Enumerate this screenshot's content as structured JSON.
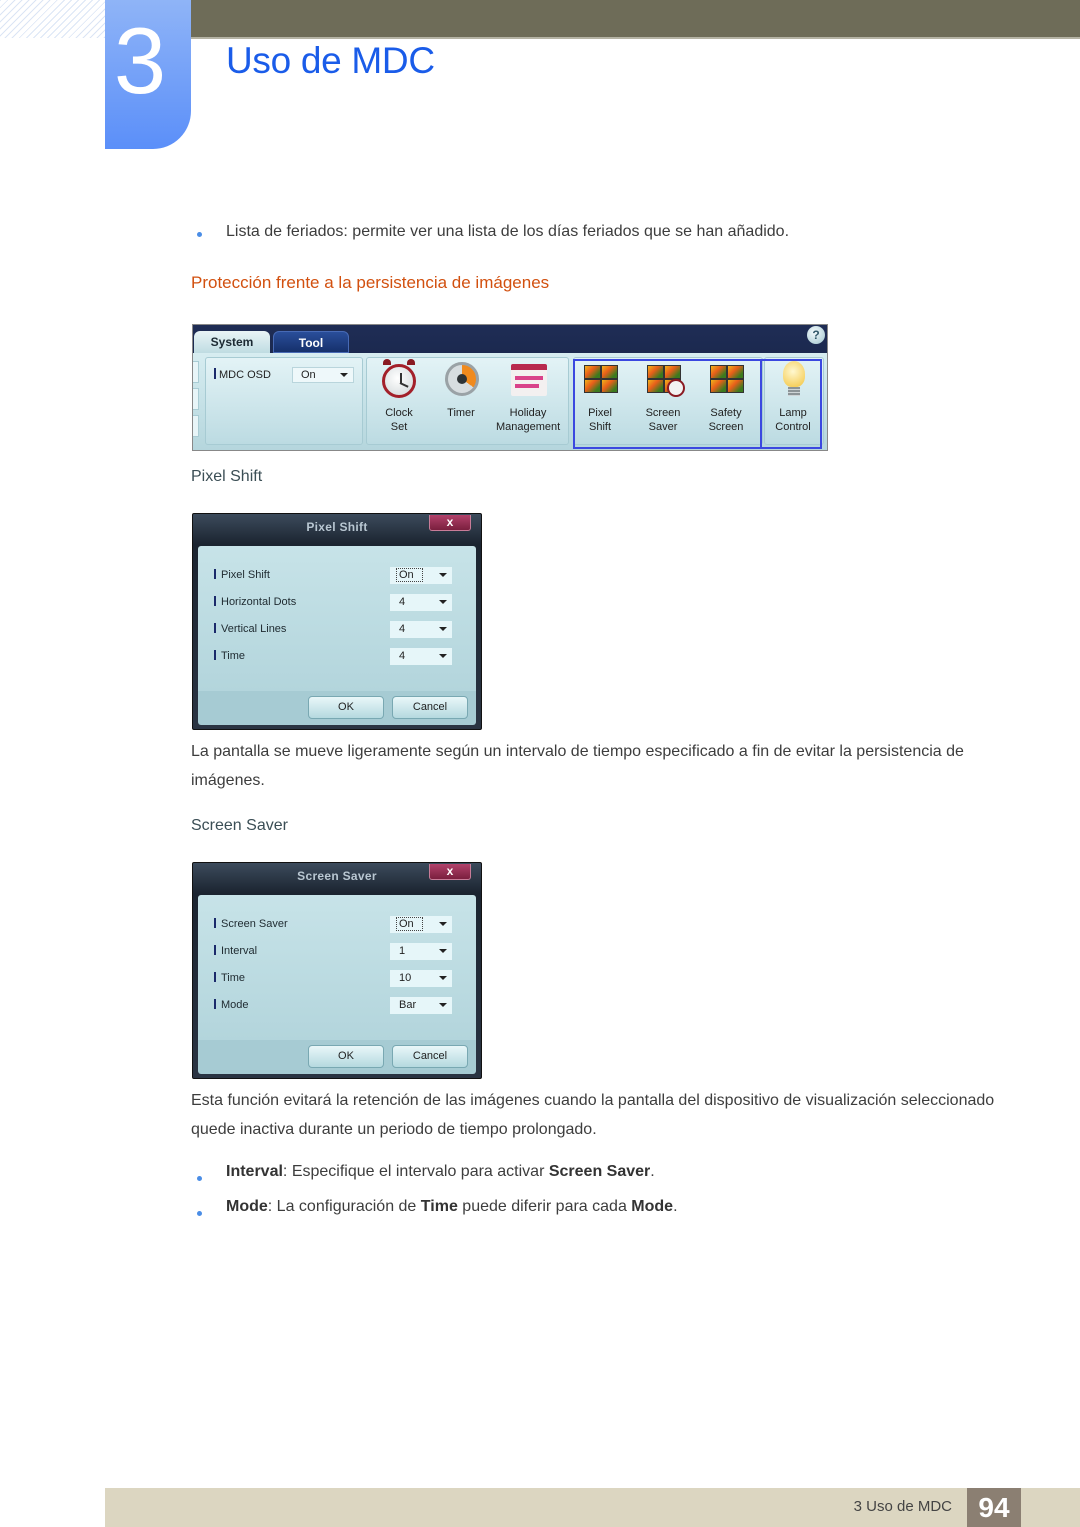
{
  "header": {
    "chapter_number": "3",
    "chapter_title": "Uso de MDC"
  },
  "content": {
    "bullet_holiday": "Lista de feriados: permite ver una lista de los días feriados que se han añadido.",
    "section_heading": "Protección frente a la persistencia de imágenes",
    "pixel_shift_heading": "Pixel Shift",
    "pixel_shift_description": "La pantalla se mueve ligeramente según un intervalo de tiempo especificado a fin de evitar la persistencia de imágenes.",
    "screen_saver_heading": "Screen Saver",
    "screen_saver_description": "Esta función evitará la retención de las imágenes cuando la pantalla del dispositivo de visualización seleccionado quede inactiva durante un periodo de tiempo prolongado.",
    "bullets": [
      {
        "term": "Interval",
        "text_before": ": Especifique el intervalo para activar ",
        "emphasis": "Screen Saver",
        "text_after": "."
      },
      {
        "term": "Mode",
        "text_before": ": La configuración de ",
        "emphasis": "Time",
        "text_mid": " puede diferir para cada ",
        "emphasis2": "Mode",
        "text_after": "."
      }
    ]
  },
  "ribbon": {
    "tabs": [
      {
        "label": "System",
        "active": true
      },
      {
        "label": "Tool",
        "active": false
      }
    ],
    "help_icon": "?",
    "mdc_osd": {
      "label": "MDC OSD",
      "value": "On"
    },
    "buttons": [
      {
        "icon": "alarm-clock-icon",
        "line1": "Clock",
        "line2": "Set"
      },
      {
        "icon": "timer-icon",
        "line1": "Timer",
        "line2": ""
      },
      {
        "icon": "calendar-icon",
        "line1": "Holiday",
        "line2": "Management"
      },
      {
        "icon": "pixel-shift-icon",
        "line1": "Pixel",
        "line2": "Shift"
      },
      {
        "icon": "screen-saver-icon",
        "line1": "Screen",
        "line2": "Saver"
      },
      {
        "icon": "safety-screen-icon",
        "line1": "Safety",
        "line2": "Screen"
      },
      {
        "icon": "lamp-bulb-icon",
        "line1": "Lamp",
        "line2": "Control"
      }
    ],
    "highlight_color": "#3b48e0"
  },
  "pixel_shift_dialog": {
    "title": "Pixel Shift",
    "close": "x",
    "rows": [
      {
        "label": "Pixel Shift",
        "value": "On"
      },
      {
        "label": "Horizontal Dots",
        "value": "4"
      },
      {
        "label": "Vertical Lines",
        "value": "4"
      },
      {
        "label": "Time",
        "value": "4"
      }
    ],
    "ok": "OK",
    "cancel": "Cancel"
  },
  "screen_saver_dialog": {
    "title": "Screen Saver",
    "close": "x",
    "rows": [
      {
        "label": "Screen Saver",
        "value": "On"
      },
      {
        "label": "Interval",
        "value": "1"
      },
      {
        "label": "Time",
        "value": "10"
      },
      {
        "label": "Mode",
        "value": "Bar"
      }
    ],
    "ok": "OK",
    "cancel": "Cancel"
  },
  "footer": {
    "label": "3 Uso de MDC",
    "page_number": "94"
  },
  "colors": {
    "title_blue": "#1a5ce9",
    "heading_orange": "#d2500f",
    "top_bar": "#6e6c58",
    "footer_bg": "#dcd6c1",
    "page_badge": "#8b7f72"
  }
}
